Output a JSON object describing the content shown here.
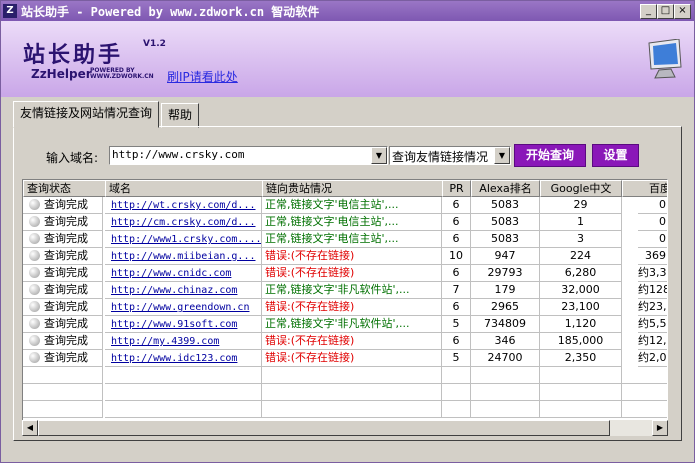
{
  "window": {
    "title": "站长助手 - Powered by www.zdwork.cn 智动软件",
    "icon_letter": "Z",
    "controls": [
      "_",
      "□",
      "×"
    ]
  },
  "header": {
    "logo_text": "站长助手",
    "version": "V1.2",
    "logo_en": "ZzHelper",
    "powered_by": "POWERED BY WWW.ZDWORK.CN",
    "brush_ip_link": "刷IP请看此处",
    "monitor_icon": "monitor-icon"
  },
  "tabs": [
    {
      "label": "友情链接及网站情况查询",
      "active": true
    },
    {
      "label": "帮助",
      "active": false
    }
  ],
  "query": {
    "domain_label": "输入域名:",
    "domain_value": "http://www.crsky.com",
    "mode_value": "查询友情链接情况",
    "start_button": "开始查询",
    "settings_button": "设置"
  },
  "table": {
    "columns": [
      "查询状态",
      "域名",
      "链向贵站情况",
      "PR",
      "Alexa排名",
      "Google中文",
      "百度"
    ],
    "rows": [
      {
        "status": "查询完成",
        "domain": "http://wt.crsky.com/d...",
        "link": "正常,链接文字'电信主站',...",
        "link_ok": true,
        "pr": "6",
        "alexa": "5083",
        "google": "29",
        "baidu": "0"
      },
      {
        "status": "查询完成",
        "domain": "http://cm.crsky.com/d...",
        "link": "正常,链接文字'电信主站',...",
        "link_ok": true,
        "pr": "6",
        "alexa": "5083",
        "google": "1",
        "baidu": "0"
      },
      {
        "status": "查询完成",
        "domain": "http://www1.crsky.com....",
        "link": "正常,链接文字'电信主站',...",
        "link_ok": true,
        "pr": "6",
        "alexa": "5083",
        "google": "3",
        "baidu": "0"
      },
      {
        "status": "查询完成",
        "domain": "http://www.miibeian.g...",
        "link": "错误:(不存在链接)",
        "link_ok": false,
        "pr": "10",
        "alexa": "947",
        "google": "224",
        "baidu": "369"
      },
      {
        "status": "查询完成",
        "domain": "http://www.cnidc.com",
        "link": "错误:(不存在链接)",
        "link_ok": false,
        "pr": "6",
        "alexa": "29793",
        "google": "6,280",
        "baidu": "约3,3"
      },
      {
        "status": "查询完成",
        "domain": "http://www.chinaz.com",
        "link": "正常,链接文字'非凡软件站',...",
        "link_ok": true,
        "pr": "7",
        "alexa": "179",
        "google": "32,000",
        "baidu": "约128,"
      },
      {
        "status": "查询完成",
        "domain": "http://www.greendown.cn",
        "link": "错误:(不存在链接)",
        "link_ok": false,
        "pr": "6",
        "alexa": "2965",
        "google": "23,100",
        "baidu": "约23,"
      },
      {
        "status": "查询完成",
        "domain": "http://www.91soft.com",
        "link": "正常,链接文字'非凡软件站',...",
        "link_ok": true,
        "pr": "5",
        "alexa": "734809",
        "google": "1,120",
        "baidu": "约5,5"
      },
      {
        "status": "查询完成",
        "domain": "http://my.4399.com",
        "link": "错误:(不存在链接)",
        "link_ok": false,
        "pr": "6",
        "alexa": "346",
        "google": "185,000",
        "baidu": "约12,70"
      },
      {
        "status": "查询完成",
        "domain": "http://www.idc123.com",
        "link": "错误:(不存在链接)",
        "link_ok": false,
        "pr": "5",
        "alexa": "24700",
        "google": "2,350",
        "baidu": "约2,0"
      }
    ]
  },
  "colors": {
    "ok": "#007000",
    "error": "#e00000",
    "accent": "#8a17b8",
    "title_bar": "#7e58b2"
  }
}
